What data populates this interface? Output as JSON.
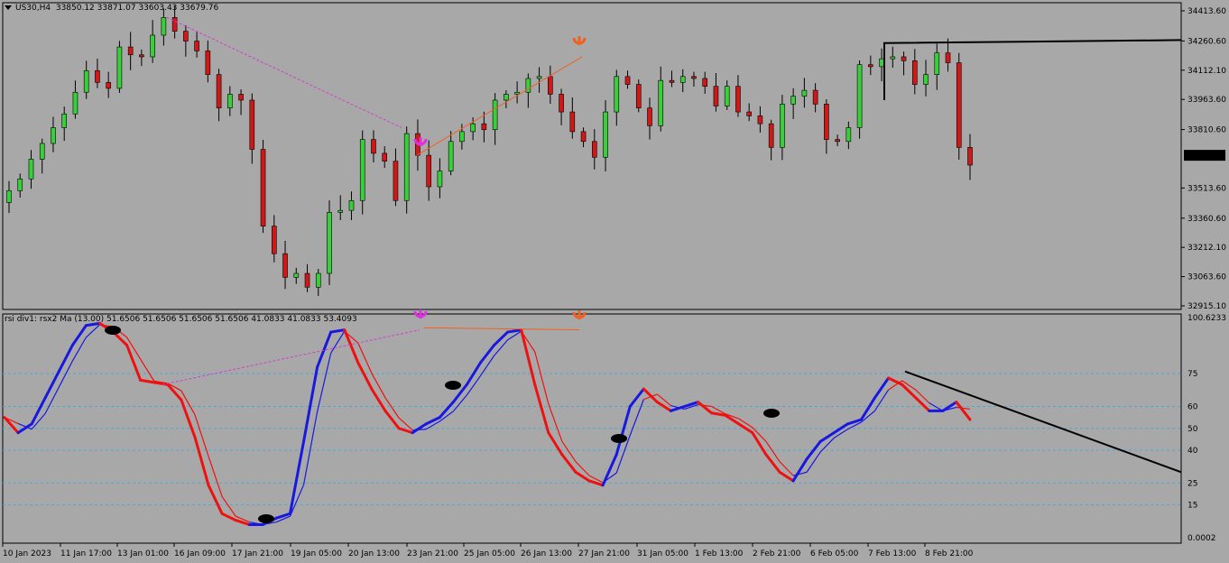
{
  "header": {
    "symbol": "US30,H4",
    "ohlc": "33850.12 33871.07 33603.43 33679.76"
  },
  "indicator_header": "rsi div1: rsx2 Ma (13.00) 51.6506 51.6506 51.6506 51.6506 41.0833 41.0833 53.4093",
  "price_labels": [
    "34413.60",
    "34260.60",
    "34112.10",
    "33963.60",
    "33810.60",
    "33513.60",
    "33360.60",
    "33212.10",
    "33063.60",
    "32915.10"
  ],
  "current_price": "33679.76",
  "rsi_labels": [
    "100.6233",
    "75",
    "60",
    "50",
    "40",
    "25",
    "15",
    "0.0002"
  ],
  "x_labels": [
    "10 Jan 2023",
    "11 Jan 17:00",
    "13 Jan 01:00",
    "16 Jan 09:00",
    "17 Jan 21:00",
    "19 Jan 05:00",
    "20 Jan 13:00",
    "23 Jan 21:00",
    "25 Jan 05:00",
    "26 Jan 13:00",
    "27 Jan 21:00",
    "31 Jan 05:00",
    "1 Feb 13:00",
    "2 Feb 21:00",
    "6 Feb 05:00",
    "7 Feb 13:00",
    "8 Feb 21:00"
  ],
  "colors": {
    "bull": "#38d038",
    "bear": "#d01818",
    "rsi_up": "#1818e0",
    "rsi_down": "#f01010",
    "level": "#4aa8d8",
    "div_bear": "#d040d0",
    "div_orange": "#f06020",
    "trend": "#000000"
  },
  "chart_data": [
    {
      "type": "candlestick",
      "title": "US30,H4",
      "ylim": [
        32915.1,
        34413.6
      ],
      "x": [
        "10 Jan 2023",
        "11 Jan 17:00",
        "13 Jan 01:00",
        "16 Jan 09:00",
        "17 Jan 21:00",
        "19 Jan 05:00",
        "20 Jan 13:00",
        "23 Jan 21:00",
        "25 Jan 05:00",
        "26 Jan 13:00",
        "27 Jan 21:00",
        "31 Jan 05:00",
        "1 Feb 13:00",
        "2 Feb 21:00",
        "6 Feb 05:00",
        "7 Feb 13:00",
        "8 Feb 21:00"
      ],
      "close_path": [
        33500,
        33560,
        33660,
        33740,
        33820,
        33890,
        34000,
        34110,
        34050,
        34020,
        34230,
        34190,
        34180,
        34290,
        34380,
        34310,
        34260,
        34210,
        34090,
        33920,
        33990,
        33960,
        33710,
        33320,
        33180,
        33060,
        33080,
        33010,
        33080,
        33390,
        33400,
        33450,
        33760,
        33690,
        33650,
        33450,
        33790,
        33680,
        33520,
        33600,
        33750,
        33800,
        33840,
        33810,
        33960,
        33990,
        34000,
        34070,
        34080,
        33990,
        33900,
        33800,
        33750,
        33670,
        33900,
        34080,
        34040,
        33920,
        33830,
        34060,
        34050,
        34080,
        34070,
        34030,
        33930,
        34030,
        33900,
        33880,
        33840,
        33720,
        33940,
        33980,
        34010,
        33940,
        33760,
        33750,
        33820,
        34140,
        34130,
        34170,
        34180,
        34160,
        34040,
        34090,
        34200,
        34150,
        33720,
        33630
      ]
    },
    {
      "type": "line",
      "title": "rsi div1: rsx2 Ma (13.00)",
      "ylim": [
        0.0002,
        100.6233
      ],
      "levels": [
        75,
        60,
        50,
        40,
        25,
        15
      ],
      "series": [
        {
          "values": [
            55,
            48,
            52,
            64,
            76,
            88,
            97,
            98,
            94,
            88,
            72,
            71,
            70,
            63,
            46,
            24,
            11,
            8,
            6,
            6,
            9,
            11,
            44,
            78,
            94,
            95,
            80,
            68,
            58,
            50,
            48,
            52,
            55,
            62,
            70,
            80,
            88,
            94,
            95,
            70,
            48,
            38,
            30,
            26,
            24,
            38,
            60,
            68,
            62,
            58,
            60,
            62,
            57,
            56,
            52,
            48,
            38,
            30,
            26,
            36,
            44,
            48,
            52,
            54,
            64,
            73,
            70,
            64,
            58,
            58,
            62,
            54
          ]
        }
      ]
    }
  ]
}
